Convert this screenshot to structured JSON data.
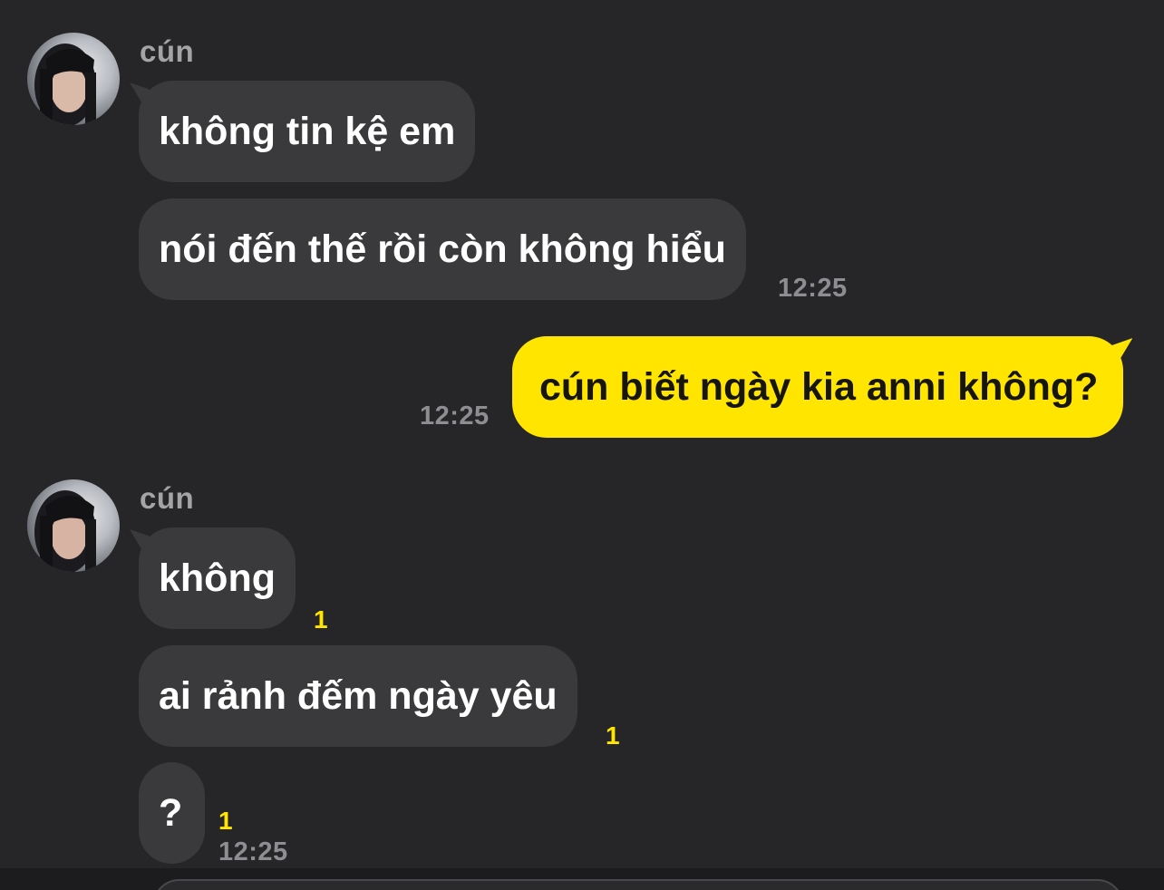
{
  "conversation": {
    "contact_name": "cún",
    "groups": [
      {
        "sender": "cún",
        "messages": [
          {
            "text": "không tin kệ em"
          },
          {
            "text": "nói đến thế rồi còn không hiểu",
            "time": "12:25"
          }
        ]
      },
      {
        "sender": "me",
        "messages": [
          {
            "text": "cún biết ngày kia anni không?",
            "time": "12:25"
          }
        ]
      },
      {
        "sender": "cún",
        "messages": [
          {
            "text": "không",
            "unread": "1"
          },
          {
            "text": "ai rảnh đếm ngày yêu",
            "unread": "1"
          },
          {
            "text": "?",
            "unread": "1",
            "time": "12:25"
          }
        ]
      }
    ]
  },
  "colors": {
    "background": "#262628",
    "incoming_bubble": "#3a3a3c",
    "outgoing_bubble": "#ffe500",
    "unread_badge": "#ffe500",
    "timestamp": "#8e8e92"
  },
  "icons": {
    "avatar": "contact-photo"
  }
}
